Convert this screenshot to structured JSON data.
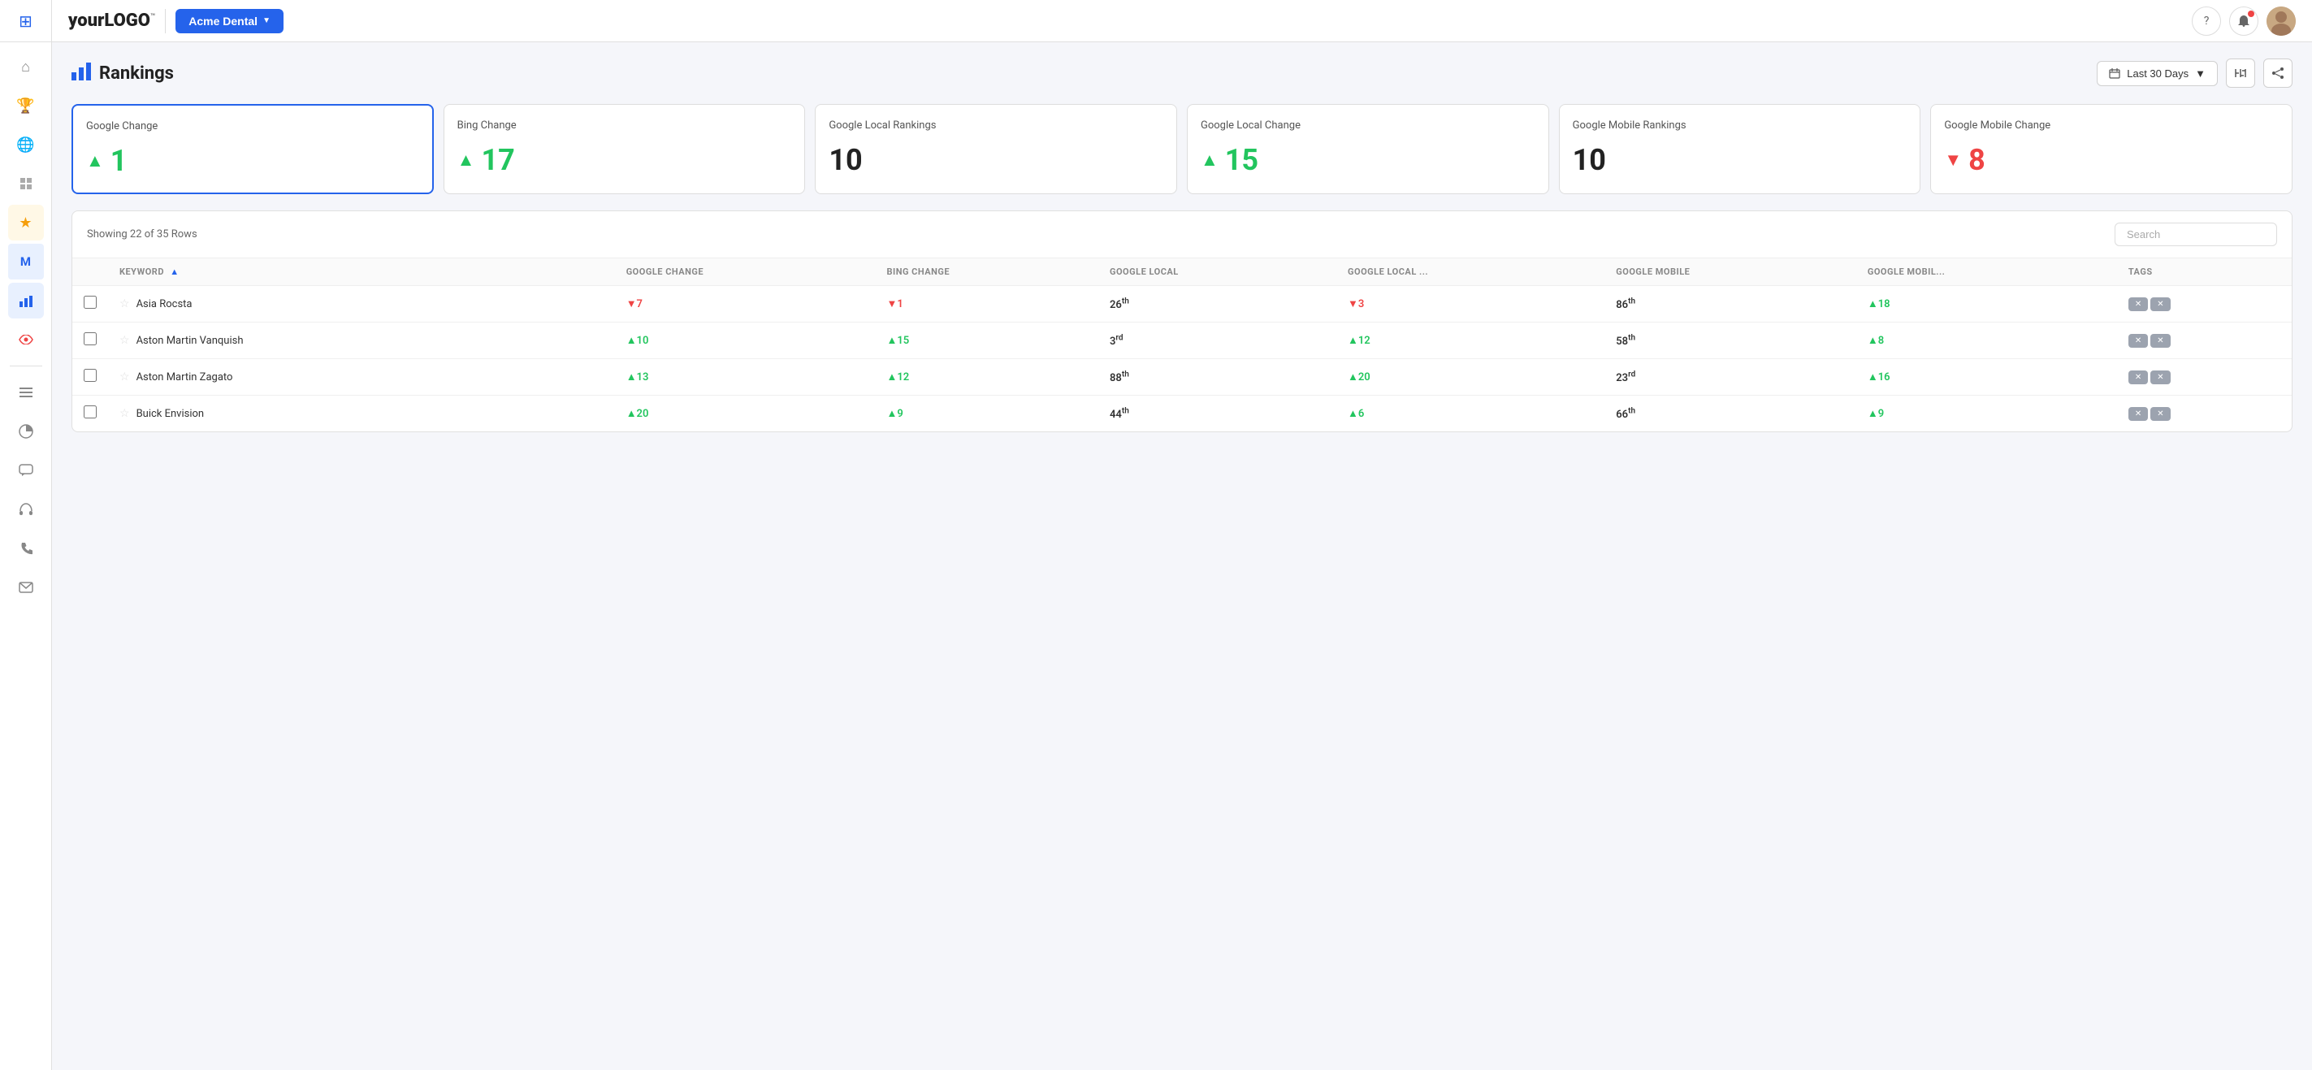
{
  "app": {
    "logo_prefix": "your",
    "logo_bold": "LOGO",
    "logo_tm": "™"
  },
  "header": {
    "client_name": "Acme Dental",
    "help_icon": "?",
    "date_range": "Last 30 Days"
  },
  "page": {
    "title": "Rankings",
    "showing_label": "Showing 22 of 35 Rows",
    "search_placeholder": "Search"
  },
  "stat_cards": [
    {
      "id": "google-change",
      "label": "Google Change",
      "value": "1",
      "direction": "up",
      "color": "green",
      "active": true
    },
    {
      "id": "bing-change",
      "label": "Bing Change",
      "value": "17",
      "direction": "up",
      "color": "green",
      "active": false
    },
    {
      "id": "google-local-rankings",
      "label": "Google Local Rankings",
      "value": "10",
      "direction": "none",
      "color": "black",
      "active": false
    },
    {
      "id": "google-local-change",
      "label": "Google Local Change",
      "value": "15",
      "direction": "up",
      "color": "green",
      "active": false
    },
    {
      "id": "google-mobile-rankings",
      "label": "Google Mobile Rankings",
      "value": "10",
      "direction": "none",
      "color": "black",
      "active": false
    },
    {
      "id": "google-mobile-change",
      "label": "Google Mobile Change",
      "value": "8",
      "direction": "down",
      "color": "red",
      "active": false
    }
  ],
  "table": {
    "columns": [
      {
        "id": "keyword",
        "label": "Keyword",
        "sortable": true
      },
      {
        "id": "google-change",
        "label": "Google Change"
      },
      {
        "id": "bing-change",
        "label": "Bing Change"
      },
      {
        "id": "google-local",
        "label": "Google Local"
      },
      {
        "id": "google-local-c",
        "label": "Google Local ..."
      },
      {
        "id": "google-mobile",
        "label": "Google Mobile"
      },
      {
        "id": "google-mobile-c",
        "label": "Google Mobil..."
      },
      {
        "id": "tags",
        "label": "Tags"
      }
    ],
    "rows": [
      {
        "keyword": "Asia Rocsta",
        "google_change": "-7",
        "google_change_dir": "down",
        "bing_change": "-1",
        "bing_change_dir": "down",
        "google_local": "26",
        "google_local_sup": "th",
        "google_local_c": "-3",
        "google_local_c_dir": "down",
        "google_mobile": "86",
        "google_mobile_sup": "th",
        "google_mobile_c": "+18",
        "google_mobile_c_dir": "up",
        "tags": [
          "x",
          "x"
        ]
      },
      {
        "keyword": "Aston Martin Vanquish",
        "google_change": "+10",
        "google_change_dir": "up",
        "bing_change": "+15",
        "bing_change_dir": "up",
        "google_local": "3",
        "google_local_sup": "rd",
        "google_local_c": "+12",
        "google_local_c_dir": "up",
        "google_mobile": "58",
        "google_mobile_sup": "th",
        "google_mobile_c": "+8",
        "google_mobile_c_dir": "up",
        "tags": [
          "x",
          "x"
        ]
      },
      {
        "keyword": "Aston Martin Zagato",
        "google_change": "+13",
        "google_change_dir": "up",
        "bing_change": "+12",
        "bing_change_dir": "up",
        "google_local": "88",
        "google_local_sup": "th",
        "google_local_c": "+20",
        "google_local_c_dir": "up",
        "google_mobile": "23",
        "google_mobile_sup": "rd",
        "google_mobile_c": "+16",
        "google_mobile_c_dir": "up",
        "tags": [
          "x",
          "x"
        ]
      },
      {
        "keyword": "Buick Envision",
        "google_change": "+20",
        "google_change_dir": "up",
        "bing_change": "+9",
        "bing_change_dir": "up",
        "google_local": "44",
        "google_local_sup": "th",
        "google_local_c": "+6",
        "google_local_c_dir": "up",
        "google_mobile": "66",
        "google_mobile_sup": "th",
        "google_mobile_c": "+9",
        "google_mobile_c_dir": "up",
        "tags": [
          "x",
          "x"
        ]
      }
    ]
  },
  "sidebar": {
    "items": [
      {
        "id": "home",
        "icon": "⌂"
      },
      {
        "id": "trophy",
        "icon": "🏆"
      },
      {
        "id": "globe",
        "icon": "🌐"
      },
      {
        "id": "layers",
        "icon": "⊞"
      },
      {
        "id": "star",
        "icon": "★"
      },
      {
        "id": "m-badge",
        "icon": "M"
      },
      {
        "id": "chart",
        "icon": "▦"
      },
      {
        "id": "eye",
        "icon": "👁"
      },
      {
        "id": "list",
        "icon": "☰"
      },
      {
        "id": "pie",
        "icon": "◑"
      },
      {
        "id": "chat",
        "icon": "💬"
      },
      {
        "id": "headphone",
        "icon": "🎧"
      },
      {
        "id": "phone",
        "icon": "📞"
      },
      {
        "id": "mail",
        "icon": "✉"
      }
    ]
  }
}
